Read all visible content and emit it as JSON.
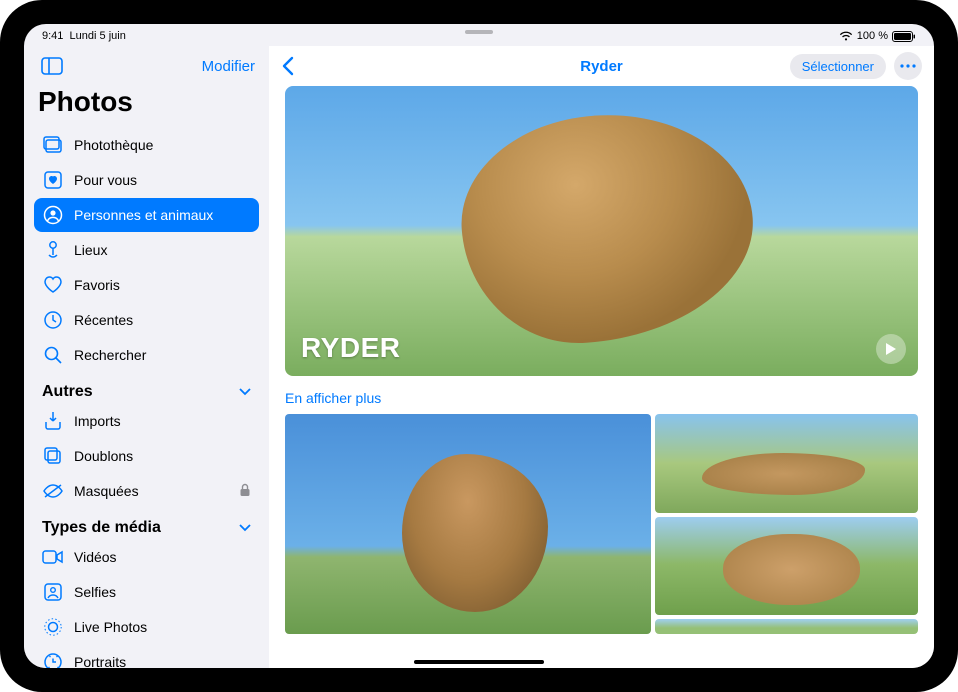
{
  "status": {
    "time": "9:41",
    "date": "Lundi 5 juin",
    "battery": "100 %"
  },
  "sidebar": {
    "edit_label": "Modifier",
    "title": "Photos",
    "items": [
      {
        "label": "Photothèque",
        "icon": "library"
      },
      {
        "label": "Pour vous",
        "icon": "heart-square"
      },
      {
        "label": "Personnes et animaux",
        "icon": "person-circle",
        "active": true
      },
      {
        "label": "Lieux",
        "icon": "pin"
      },
      {
        "label": "Favoris",
        "icon": "heart"
      },
      {
        "label": "Récentes",
        "icon": "clock"
      },
      {
        "label": "Rechercher",
        "icon": "search"
      }
    ],
    "section_others": "Autres",
    "others": [
      {
        "label": "Imports",
        "icon": "import"
      },
      {
        "label": "Doublons",
        "icon": "duplicates"
      },
      {
        "label": "Masquées",
        "icon": "hidden",
        "locked": true
      }
    ],
    "section_media": "Types de média",
    "media": [
      {
        "label": "Vidéos",
        "icon": "video"
      },
      {
        "label": "Selfies",
        "icon": "selfie"
      },
      {
        "label": "Live Photos",
        "icon": "live"
      },
      {
        "label": "Portraits",
        "icon": "portrait"
      }
    ]
  },
  "header": {
    "title": "Ryder",
    "select_label": "Sélectionner"
  },
  "hero": {
    "name": "RYDER"
  },
  "show_more_label": "En afficher plus"
}
